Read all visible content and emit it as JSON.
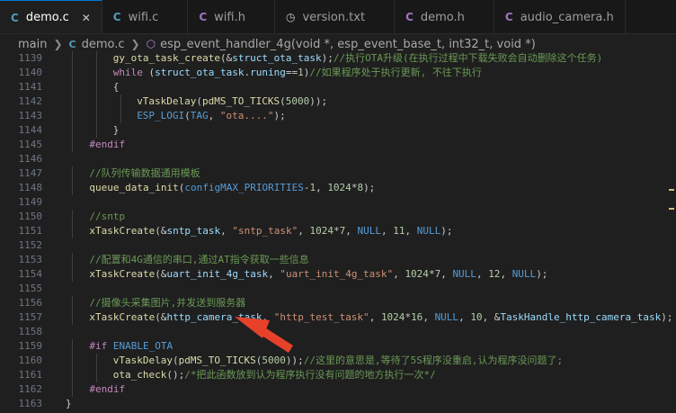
{
  "tabs": [
    {
      "icon": "C",
      "label": "demo.c",
      "active": true,
      "close": "✕"
    },
    {
      "icon": "C",
      "label": "wifi.c",
      "active": false
    },
    {
      "icon": "C",
      "label": "wifi.h",
      "active": false
    },
    {
      "icon": "◷",
      "label": "version.txt",
      "active": false
    },
    {
      "icon": "C",
      "label": "demo.h",
      "active": false
    },
    {
      "icon": "C",
      "label": "audio_camera.h",
      "active": false
    }
  ],
  "breadcrumb": {
    "folder": "main",
    "file_icon": "C",
    "file": "demo.c",
    "symbol_icon": "⬡",
    "symbol": "esp_event_handler_4g(void *, esp_event_base_t, int32_t, void *)"
  },
  "lines": [
    {
      "n": "1139",
      "code": "gy_ota_task_create(&struct_ota_task);//执行OTA升级(在执行过程中下载失败会自动删除这个任务)"
    },
    {
      "n": "1140",
      "code": "while (struct_ota_task.runing==1)//如果程序处于执行更新, 不往下执行"
    },
    {
      "n": "1141",
      "code": "{"
    },
    {
      "n": "1142",
      "code": "vTaskDelay(pdMS_TO_TICKS(5000));"
    },
    {
      "n": "1143",
      "code": "ESP_LOGI(TAG, \"ota....\");"
    },
    {
      "n": "1144",
      "code": "}"
    },
    {
      "n": "1145",
      "code": "#endif"
    },
    {
      "n": "1146",
      "code": ""
    },
    {
      "n": "1147",
      "code": "//队列传输数据通用模板"
    },
    {
      "n": "1148",
      "code": "queue_data_init(configMAX_PRIORITIES-1, 1024*8);"
    },
    {
      "n": "1149",
      "code": ""
    },
    {
      "n": "1150",
      "code": "//sntp"
    },
    {
      "n": "1151",
      "code": "xTaskCreate(&sntp_task, \"sntp_task\", 1024*7, NULL, 11, NULL);"
    },
    {
      "n": "1152",
      "code": ""
    },
    {
      "n": "1153",
      "code": "//配置和4G通信的串口,通过AT指令获取一些信息"
    },
    {
      "n": "1154",
      "code": "xTaskCreate(&uart_init_4g_task, \"uart_init_4g_task\", 1024*7, NULL, 12, NULL);"
    },
    {
      "n": "1155",
      "code": ""
    },
    {
      "n": "1156",
      "code": "//摄像头采集图片,并发送到服务器"
    },
    {
      "n": "1157",
      "code": "xTaskCreate(&http_camera_task, \"http_test_task\", 1024*16, NULL, 10, &TaskHandle_http_camera_task);"
    },
    {
      "n": "1158",
      "code": ""
    },
    {
      "n": "1159",
      "code": "#if ENABLE_OTA"
    },
    {
      "n": "1160",
      "code": "vTaskDelay(pdMS_TO_TICKS(5000));//这里的意思是,等待了5S程序没重启,认为程序没问题了;"
    },
    {
      "n": "1161",
      "code": "ota_check();/*把此函数放到认为程序执行没有问题的地方执行一次*/"
    },
    {
      "n": "1162",
      "code": "#endif"
    },
    {
      "n": "1163",
      "code": "}"
    }
  ],
  "colors": {
    "accent": "#0078d4",
    "arrow": "#e8412a",
    "editor_bg": "#1f1f1f"
  }
}
